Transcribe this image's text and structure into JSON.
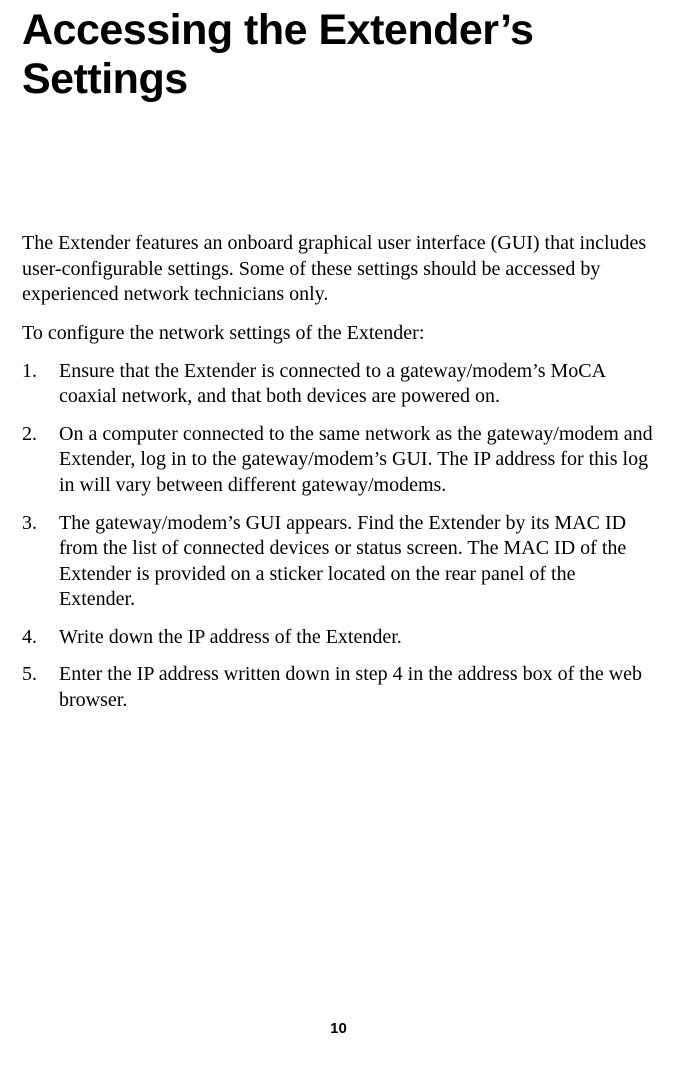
{
  "title": "Accessing the Extender’s Settings",
  "intro": "The Extender features an onboard graphical user interface (GUI) that includes user-configurable settings. Some of these settings should be accessed by experienced network technicians only.",
  "lead": "To configure the network settings of the Extender:",
  "steps": [
    "Ensure that the Extender is connected to a gateway/modem’s MoCA coaxial network, and that both devices are powered on.",
    "On a computer connected to the same network as the gateway/modem and Extender, log in to the gateway/modem’s GUI. The IP address for this log in will vary between different gateway/modems.",
    "The gateway/modem’s GUI appears. Find the Extender by its MAC ID from the list of connected devices or status screen. The MAC ID of the Extender is provided on a sticker located on the rear panel of the Extender.",
    "Write down the IP address of the Extender.",
    "Enter the IP address written down in step 4 in the address box of the web browser."
  ],
  "page_number": "10"
}
